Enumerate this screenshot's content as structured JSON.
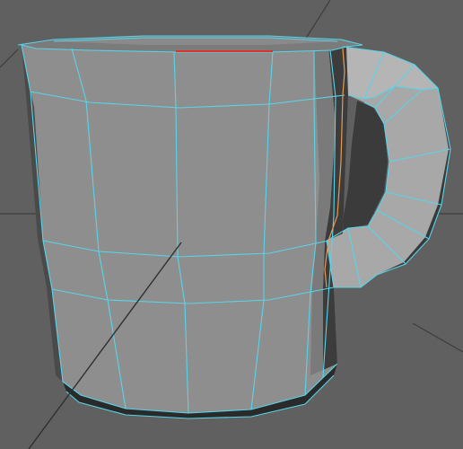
{
  "viewport": {
    "background_color": "#606060",
    "grid_line_color": "#3d3d3d",
    "wireframe_color": "#58d4ea",
    "selected_edge_color": "#e0302a",
    "highlight_edge_color": "#e59a55",
    "surface_colors": {
      "body": "#8e8e8e",
      "body_light": "#9d9d9d",
      "body_dark": "#2f2f2f",
      "handle_top": "#b3b3b3",
      "handle_side": "#a6a6a6",
      "handle_dark": "#3a3a3a",
      "rim_inner": "#7b7b7b"
    }
  }
}
